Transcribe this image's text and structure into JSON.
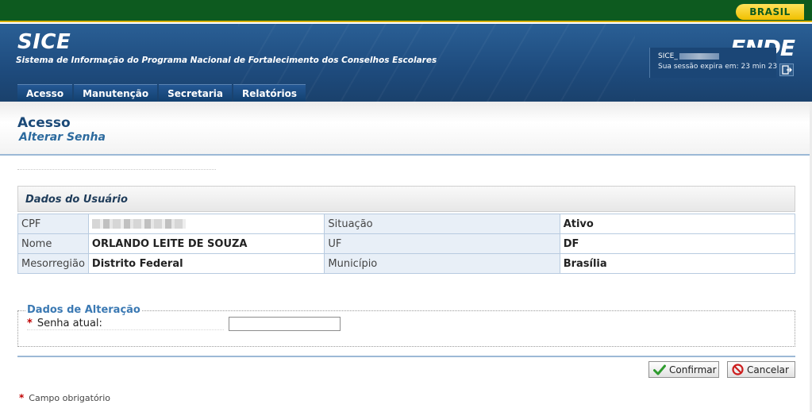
{
  "gov_bar": {
    "brand_label": "BRASIL"
  },
  "header": {
    "title": "SICE",
    "subtitle": "Sistema de Informação do Programa Nacional de Fortalecimento dos Conselhos Escolares",
    "logo_text": "FNDE"
  },
  "nav": {
    "tabs": [
      {
        "label": "Acesso"
      },
      {
        "label": "Manutenção"
      },
      {
        "label": "Secretaria"
      },
      {
        "label": "Relatórios"
      }
    ]
  },
  "session": {
    "user_prefix": "SICE_",
    "expire_text": "Sua sessão expira em: 23 min 23"
  },
  "page": {
    "title": "Acesso",
    "subtitle": "Alterar Senha"
  },
  "user_section": {
    "header": "Dados do Usuário",
    "rows": [
      {
        "label1": "CPF",
        "value1": "",
        "label2": "Situação",
        "value2": "Ativo"
      },
      {
        "label1": "Nome",
        "value1": "ORLANDO LEITE DE SOUZA",
        "label2": "UF",
        "value2": "DF"
      },
      {
        "label1": "Mesorregião",
        "value1": "Distrito Federal",
        "label2": "Município",
        "value2": "Brasília"
      }
    ]
  },
  "change_section": {
    "legend": "Dados de Alteração",
    "required_mark": "*",
    "field_label": "Senha atual:",
    "field_value": ""
  },
  "buttons": {
    "confirm_label": "Confirmar",
    "cancel_label": "Cancelar"
  },
  "footnote": {
    "mark": "*",
    "text": "Campo obrigatório"
  },
  "colors": {
    "header_blue": "#1e4b7d",
    "gov_green": "#0d5a1f",
    "brand_yellow": "#f0c000",
    "required_red": "#c00000"
  }
}
